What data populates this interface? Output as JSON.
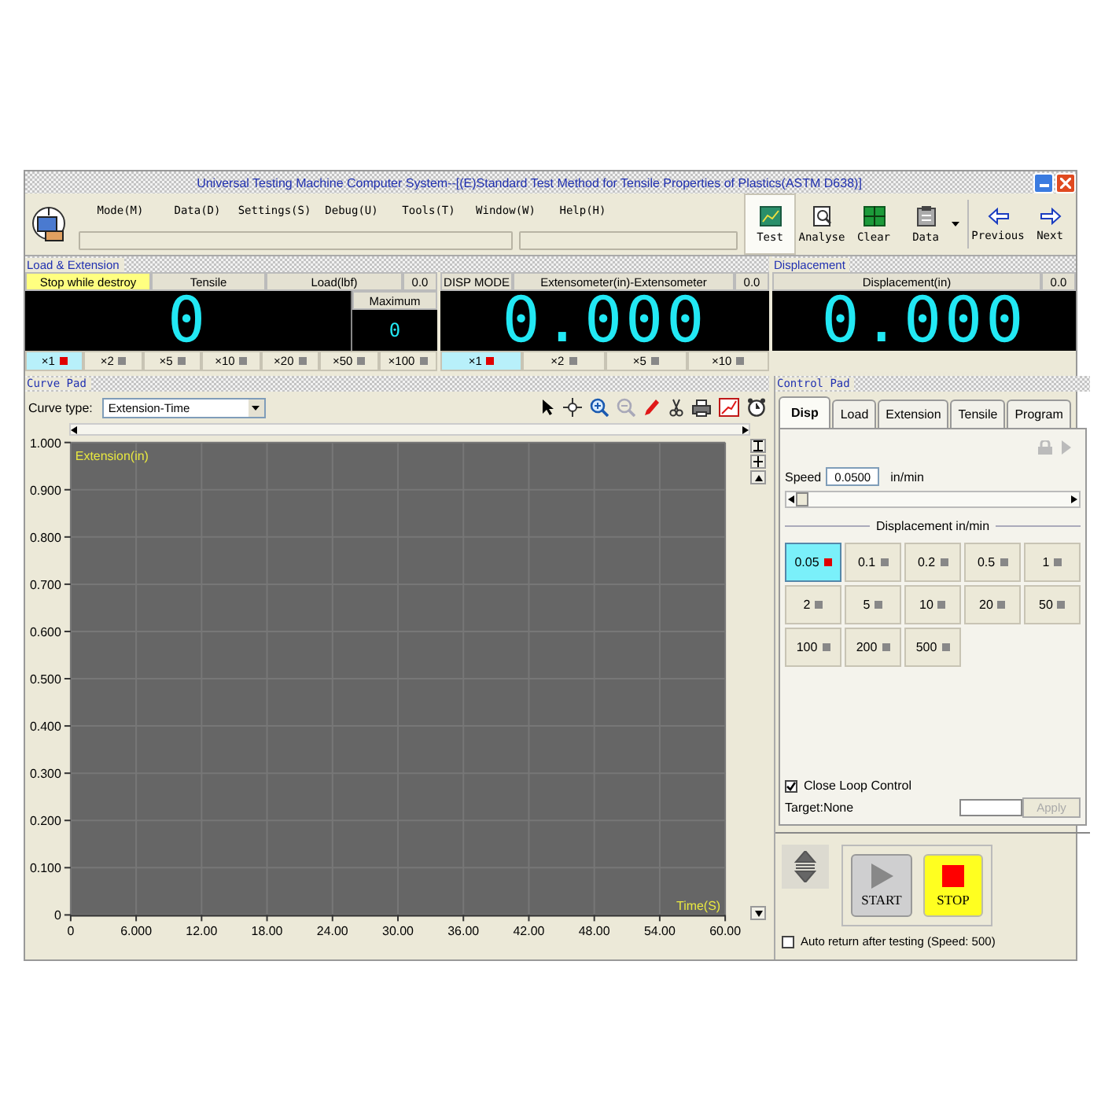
{
  "window": {
    "title": "Universal Testing Machine Computer System--[(E)Standard Test Method for Tensile Properties of Plastics(ASTM D638)]"
  },
  "menu": [
    "Mode(M)",
    "Data(D)",
    "Settings(S)",
    "Debug(U)",
    "Tools(T)",
    "Window(W)",
    "Help(H)"
  ],
  "toolbar": [
    {
      "label": "Test",
      "selected": true
    },
    {
      "label": "Analyse",
      "selected": false
    },
    {
      "label": "Clear",
      "selected": false
    },
    {
      "label": "Data",
      "selected": false
    },
    {
      "label": "Previous",
      "selected": false
    },
    {
      "label": "Next",
      "selected": false
    }
  ],
  "load_extension": {
    "title": "Load & Extension",
    "load": {
      "mode": "Stop while destroy",
      "test": "Tensile",
      "channel": "Load(lbf)",
      "reading": "0.0",
      "value": "0",
      "maximum_label": "Maximum",
      "maximum": "0",
      "multipliers": [
        {
          "label": "×1",
          "selected": true
        },
        {
          "label": "×2",
          "selected": false
        },
        {
          "label": "×5",
          "selected": false
        },
        {
          "label": "×10",
          "selected": false
        },
        {
          "label": "×20",
          "selected": false
        },
        {
          "label": "×50",
          "selected": false
        },
        {
          "label": "×100",
          "selected": false
        }
      ]
    },
    "extension": {
      "mode": "DISP MODE",
      "channel": "Extensometer(in)-Extensometer",
      "reading": "0.0",
      "value": "0.000",
      "multipliers": [
        {
          "label": "×1",
          "selected": true
        },
        {
          "label": "×2",
          "selected": false
        },
        {
          "label": "×5",
          "selected": false
        },
        {
          "label": "×10",
          "selected": false
        }
      ]
    }
  },
  "displacement": {
    "title": "Displacement",
    "channel": "Displacement(in)",
    "reading": "0.0",
    "value": "0.000"
  },
  "curve_pad": {
    "title": "Curve Pad",
    "curve_type_label": "Curve type:",
    "curve_type": "Extension-Time",
    "chart_data": {
      "type": "line",
      "grid": true,
      "xlabel": "Time(S)",
      "ylabel": "Extension(in)",
      "xlim": [
        0,
        60
      ],
      "ylim": [
        0,
        1
      ],
      "xticks": [
        0,
        {
          "value": 6,
          "label": "6.000"
        },
        {
          "value": 12,
          "label": "12.00"
        },
        {
          "value": 18,
          "label": "18.00"
        },
        {
          "value": 24,
          "label": "24.00"
        },
        {
          "value": 30,
          "label": "30.00"
        },
        {
          "value": 36,
          "label": "36.00"
        },
        {
          "value": 42,
          "label": "42.00"
        },
        {
          "value": 48,
          "label": "48.00"
        },
        {
          "value": 54,
          "label": "54.00"
        },
        {
          "value": 60,
          "label": "60.00"
        }
      ],
      "yticks": [
        0,
        {
          "value": 0.1,
          "label": "0.100"
        },
        {
          "value": 0.2,
          "label": "0.200"
        },
        {
          "value": 0.3,
          "label": "0.300"
        },
        {
          "value": 0.4,
          "label": "0.400"
        },
        {
          "value": 0.5,
          "label": "0.500"
        },
        {
          "value": 0.6,
          "label": "0.600"
        },
        {
          "value": 0.7,
          "label": "0.700"
        },
        {
          "value": 0.8,
          "label": "0.800"
        },
        {
          "value": 0.9,
          "label": "0.900"
        },
        {
          "value": 1,
          "label": "1.000"
        }
      ]
    }
  },
  "control_pad": {
    "title": "Control Pad",
    "tabs": [
      {
        "label": "Disp",
        "selected": true
      },
      {
        "label": "Load",
        "selected": false
      },
      {
        "label": "Extension",
        "selected": false
      },
      {
        "label": "Tensile",
        "selected": false
      },
      {
        "label": "Program",
        "selected": false
      }
    ],
    "speed_label": "Speed",
    "speed": "0.0500",
    "speed_unit": "in/min",
    "speed_slider": {
      "level": 0
    },
    "group_label": "Displacement in/min",
    "speeds": [
      {
        "label": "0.05",
        "selected": true
      },
      {
        "label": "0.1",
        "selected": false
      },
      {
        "label": "0.2",
        "selected": false
      },
      {
        "label": "0.5",
        "selected": false
      },
      {
        "label": "1",
        "selected": false
      },
      {
        "label": "2",
        "selected": false
      },
      {
        "label": "5",
        "selected": false
      },
      {
        "label": "10",
        "selected": false
      },
      {
        "label": "20",
        "selected": false
      },
      {
        "label": "50",
        "selected": false
      },
      {
        "label": "100",
        "selected": false
      },
      {
        "label": "200",
        "selected": false
      },
      {
        "label": "500",
        "selected": false
      }
    ],
    "close_loop": {
      "label": "Close Loop Control",
      "checked": true
    },
    "target_label": "Target:None",
    "apply": {
      "label": "Apply",
      "disabled": true
    }
  },
  "controls": {
    "start": "START",
    "stop": "STOP",
    "auto_return": {
      "label": "Auto return after testing (Speed: 500)",
      "checked": false
    }
  }
}
